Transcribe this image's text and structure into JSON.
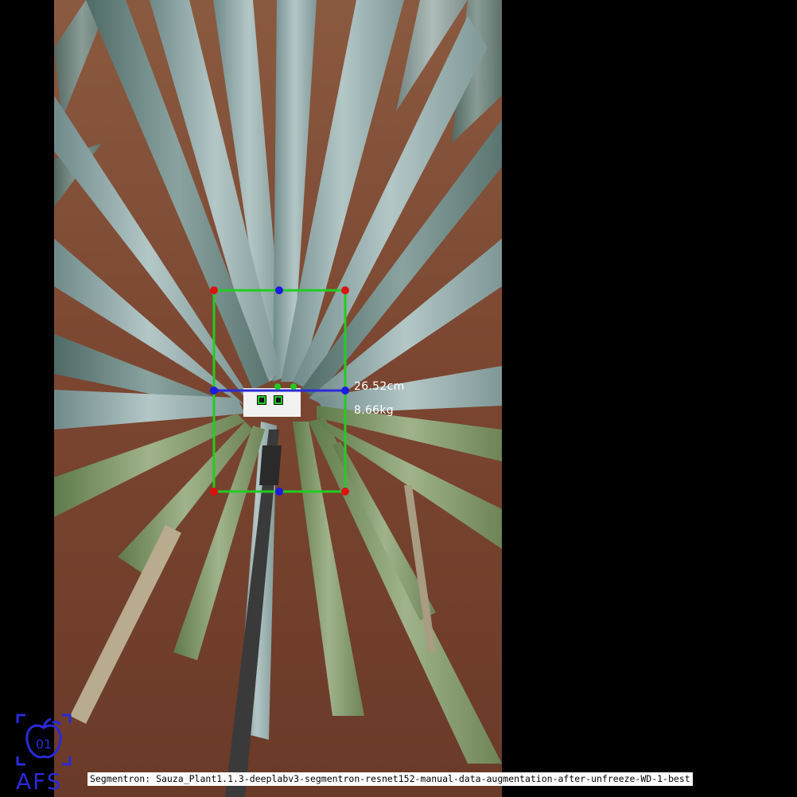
{
  "image": {
    "description_icon": "agave-plant-photo",
    "colors": {
      "box": "#22cc22",
      "corner": "#dd1111",
      "midpoint": "#1a1ae0",
      "diameter_line": "#2a2ad8",
      "logo": "#2a2ad8"
    }
  },
  "measurements": {
    "diameter": "26.52cm",
    "weight": "8.66kg"
  },
  "caption": "Segmentron: Sauza_Plant1.1.3-deeplabv3-segmentron-resnet152-manual-data-augmentation-after-unfreeze-WD-1-best",
  "logo": {
    "badge_text": "01",
    "text": "AFS"
  }
}
